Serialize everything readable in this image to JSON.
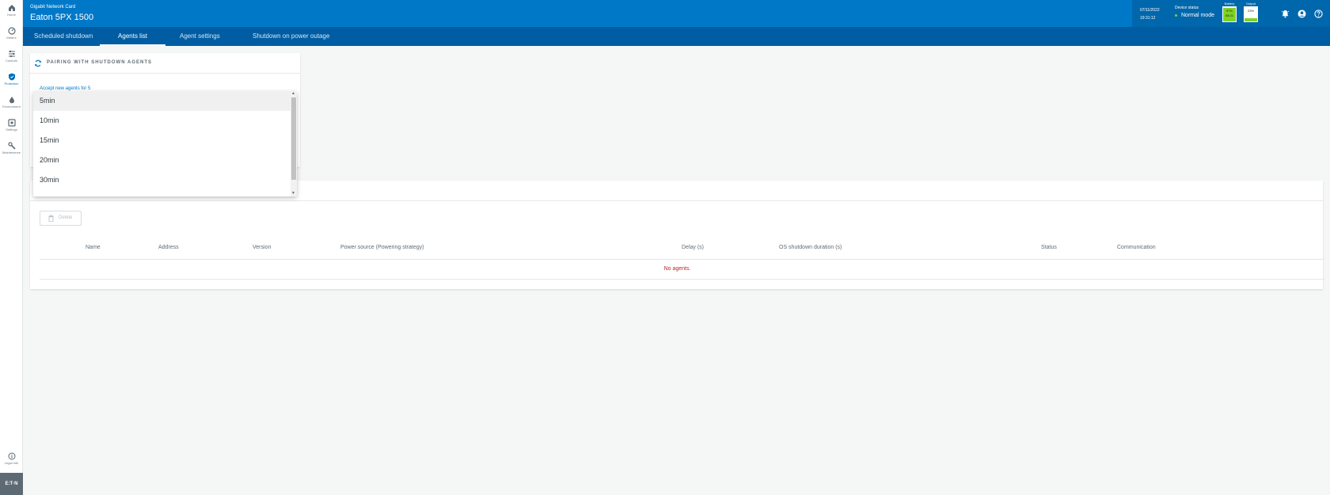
{
  "sidebar": {
    "items": [
      {
        "label": "Home",
        "icon": "home-icon",
        "active": false
      },
      {
        "label": "Meters",
        "icon": "meter-icon",
        "active": false
      },
      {
        "label": "Controls",
        "icon": "controls-icon",
        "active": false
      },
      {
        "label": "Protection",
        "icon": "shield-icon",
        "active": true
      },
      {
        "label": "Environment",
        "icon": "drop-icon",
        "active": false
      },
      {
        "label": "Settings",
        "icon": "settings-icon",
        "active": false
      },
      {
        "label": "Maintenance",
        "icon": "wrench-icon",
        "active": false
      }
    ],
    "legal_label": "Legal info",
    "logo": "E:T·N"
  },
  "header": {
    "subtitle": "Gigabit Network Card",
    "title": "Eaton 5PX 1500",
    "date": "07/11/2022",
    "time": "19:31:12",
    "device_status_label": "Device status",
    "device_status_value": "Normal mode",
    "battery": {
      "label": "Battery",
      "percent_text": "97%",
      "time_text": "58:21",
      "level": 0.97,
      "color": "#7ed321"
    },
    "output": {
      "label": "Output",
      "percent_text": "23%",
      "level": 0.23,
      "color": "#7ed321"
    }
  },
  "tabs": [
    {
      "label": "Scheduled shutdown",
      "active": false
    },
    {
      "label": "Agents list",
      "active": true
    },
    {
      "label": "Agent settings",
      "active": false
    },
    {
      "label": "Shutdown on power outage",
      "active": false
    }
  ],
  "pairing": {
    "title": "PAIRING WITH SHUTDOWN AGENTS",
    "text": "Accept new agents for 5"
  },
  "dropdown": {
    "options": [
      "5min",
      "10min",
      "15min",
      "20min",
      "30min"
    ],
    "selected": "5min"
  },
  "agents": {
    "delete_label": "Delete",
    "columns": [
      "Name",
      "Address",
      "Version",
      "Power source (Powering strategy)",
      "Delay (s)",
      "OS shutdown duration (s)",
      "Status",
      "Communication"
    ],
    "empty_message": "No agents."
  },
  "colors": {
    "brand": "#0078c8",
    "tabbar": "#005da3",
    "error": "#b52a2a"
  }
}
